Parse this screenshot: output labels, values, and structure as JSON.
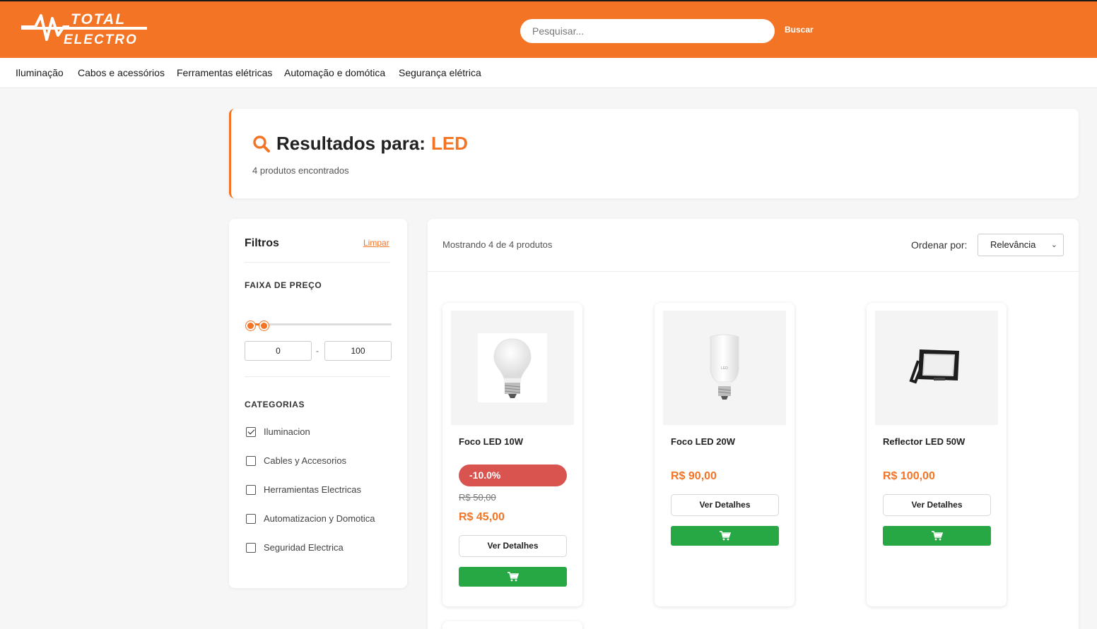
{
  "header": {
    "logo_text_top": "TOTAL",
    "logo_text_bottom": "ELECTRO",
    "search_placeholder": "Pesquisar...",
    "search_button": "Buscar",
    "brand_color": "#f37424"
  },
  "nav": {
    "items": [
      "Iluminação",
      "Cabos e acessórios",
      "Ferramentas elétricas",
      "Automação e domótica",
      "Segurança elétrica"
    ]
  },
  "results": {
    "label": "Resultados para:",
    "term": "LED",
    "count_text": "4 produtos encontrados",
    "icon": "search-icon"
  },
  "filters": {
    "title": "Filtros",
    "clear_label": "Limpar",
    "price_section": "FAIXA DE PREÇO",
    "price_min": "0",
    "price_max": "100",
    "price_separator": "-",
    "categories_section": "CATEGORIAS",
    "categories": [
      {
        "label": "Iluminacion",
        "checked": true
      },
      {
        "label": "Cables y Accesorios",
        "checked": false
      },
      {
        "label": "Herramientas Electricas",
        "checked": false
      },
      {
        "label": "Automatizacion y Domotica",
        "checked": false
      },
      {
        "label": "Seguridad Electrica",
        "checked": false
      }
    ]
  },
  "listing": {
    "showing_text": "Mostrando 4 de 4 produtos",
    "sort_label": "Ordenar por:",
    "sort_value": "Relevância",
    "products": [
      {
        "name": "Foco LED 10W",
        "discount": "-10.0%",
        "old_price": "R$ 50,00",
        "price": "R$ 45,00",
        "details_label": "Ver Detalhes",
        "image": "bulb-image"
      },
      {
        "name": "Foco LED 20W",
        "price": "R$ 90,00",
        "details_label": "Ver Detalhes",
        "image": "bulb-image"
      },
      {
        "name": "Reflector LED 50W",
        "price": "R$ 100,00",
        "details_label": "Ver Detalhes",
        "image": "floodlight-image"
      }
    ]
  }
}
